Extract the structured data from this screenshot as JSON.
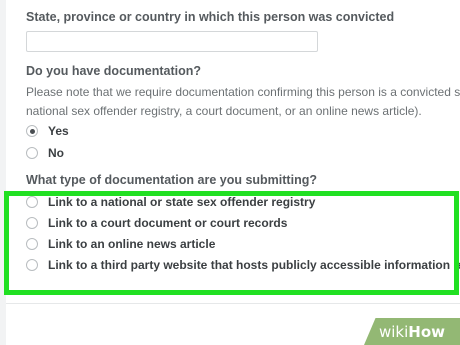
{
  "form": {
    "state_label": "State, province or country in which this person was convicted",
    "state_value": "",
    "documentation_question": "Do you have documentation?",
    "documentation_note_line1": "Please note that we require documentation confirming this person is a convicted sex",
    "documentation_note_line2": "national sex offender registry, a court document, or an online news article).",
    "options_yes_no": [
      {
        "label": "Yes",
        "checked": true
      },
      {
        "label": "No",
        "checked": false
      }
    ],
    "type_question": "What type of documentation are you submitting?",
    "doc_types": [
      {
        "label": "Link to a national or state sex offender registry",
        "checked": false
      },
      {
        "label": "Link to a court document or court records",
        "checked": false
      },
      {
        "label": "Link to an online news article",
        "checked": false
      },
      {
        "label": "Link to a third party website that hosts publicly accessible information (ex",
        "checked": false
      }
    ]
  },
  "watermark": {
    "part1": "wiki",
    "part2": "How"
  },
  "colors": {
    "highlight": "#21e022",
    "badge": "#93b874"
  }
}
